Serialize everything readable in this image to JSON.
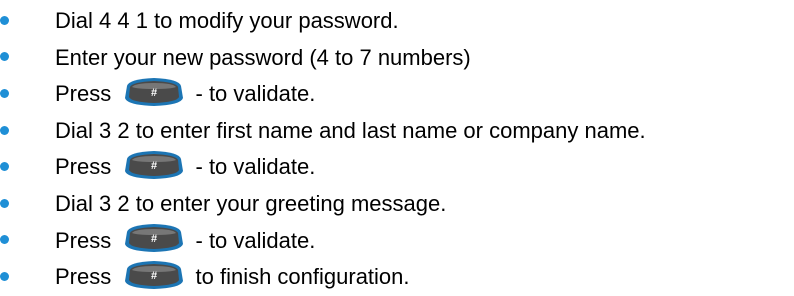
{
  "instructions": {
    "items": [
      {
        "type": "text",
        "text": "Dial 4 4 1 to modify your password."
      },
      {
        "type": "text",
        "text": "Enter your new password (4 to 7 numbers)"
      },
      {
        "type": "key",
        "before": "Press",
        "key_icon": "hash-key-icon",
        "key_symbol": "#",
        "after": "- to validate."
      },
      {
        "type": "text",
        "text": "Dial 3 2 to enter first name and last name or company name."
      },
      {
        "type": "key",
        "before": "Press",
        "key_icon": "hash-key-icon",
        "key_symbol": "#",
        "after": "- to validate."
      },
      {
        "type": "text",
        "text": "Dial 3 2 to enter your greeting message."
      },
      {
        "type": "key",
        "before": "Press",
        "key_icon": "hash-key-icon",
        "key_symbol": "#",
        "after": "- to validate."
      },
      {
        "type": "key",
        "before": "Press",
        "key_icon": "hash-key-icon",
        "key_symbol": "#",
        "after": "to finish configuration."
      }
    ]
  },
  "colors": {
    "bullet": "#1f8fd6",
    "text": "#000000",
    "key_fill": "#4a4a4a",
    "key_rim": "#1c75b4"
  }
}
